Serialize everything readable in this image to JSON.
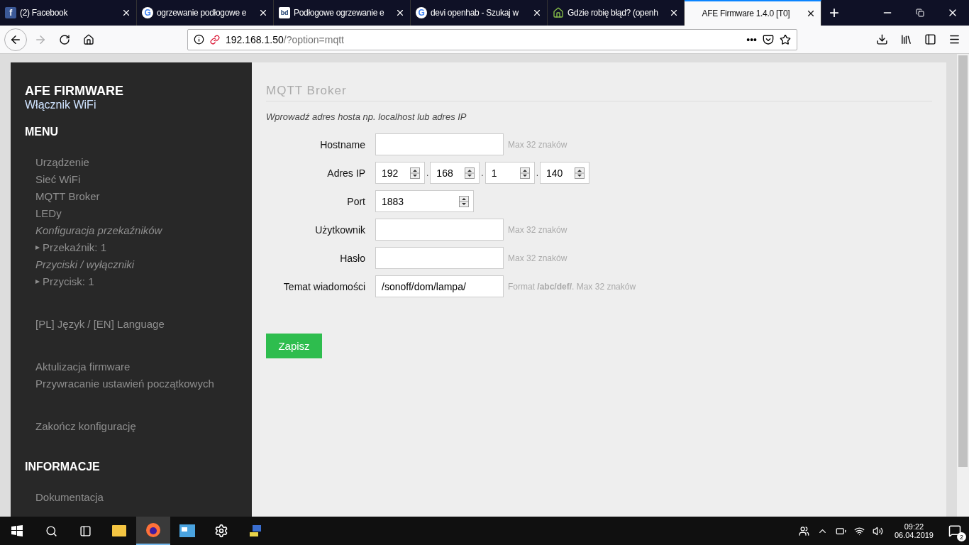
{
  "browser": {
    "tabs": [
      {
        "title": "(2) Facebook",
        "kind": "facebook",
        "favicon_text": "f",
        "selected": false
      },
      {
        "title": "ogrzewanie podłogowe e",
        "kind": "google",
        "favicon_text": "G",
        "selected": false
      },
      {
        "title": "Podłogowe ogrzewanie e",
        "kind": "letters",
        "favicon_text": "bd",
        "selected": false
      },
      {
        "title": "devi openhab - Szukaj w",
        "kind": "google",
        "favicon_text": "G",
        "selected": false
      },
      {
        "title": "Gdzie robię błąd? (openh",
        "kind": "house",
        "selected": false
      },
      {
        "title": "AFE Firmware 1.4.0 [T0]",
        "selected": true
      }
    ],
    "new_tab": "+",
    "url_host": "192.168.1.50",
    "url_path": "/?option=mqtt",
    "page_actions": "•••",
    "forward_disabled": true
  },
  "sidebar": {
    "title": "AFE FIRMWARE",
    "subtitle": "Włącznik WiFi",
    "menu_heading": "MENU",
    "groups": [
      [
        {
          "label": "Urządzenie",
          "kind": "link"
        },
        {
          "label": "Sieć WiFi",
          "kind": "link"
        },
        {
          "label": "MQTT Broker",
          "kind": "link"
        },
        {
          "label": "LEDy",
          "kind": "link"
        },
        {
          "label": "Konfiguracja przekaźników",
          "kind": "section"
        },
        {
          "label": "Przekaźnik: 1",
          "kind": "sub"
        },
        {
          "label": "Przyciski / wyłączniki",
          "kind": "section"
        },
        {
          "label": "Przycisk: 1",
          "kind": "sub"
        }
      ],
      [
        {
          "label": "[PL] Język / [EN] Language",
          "kind": "link"
        }
      ],
      [
        {
          "label": "Aktulizacja firmware",
          "kind": "link"
        },
        {
          "label": "Przywracanie ustawień początkowych",
          "kind": "link"
        }
      ],
      [
        {
          "label": "Zakończ konfigurację",
          "kind": "link"
        }
      ]
    ],
    "info_heading": "INFORMACJE",
    "info_items": [
      {
        "label": "Dokumentacja"
      }
    ]
  },
  "main": {
    "title": "MQTT Broker",
    "intro": "Wprowadź adres hosta np. localhost lub adres IP",
    "fields": [
      {
        "label": "Hostname",
        "kind": "text",
        "hint": "Max 32 znaków"
      },
      {
        "label": "Adres IP",
        "kind": "ip",
        "separator": ".",
        "octets": [
          "192",
          "168",
          "1",
          "140"
        ]
      },
      {
        "label": "Port",
        "kind": "number",
        "value": "1883"
      },
      {
        "label": "Użytkownik",
        "kind": "text",
        "hint": "Max 32 znaków"
      },
      {
        "label": "Hasło",
        "kind": "text",
        "hint": "Max 32 znaków"
      },
      {
        "label": "Temat wiadomości",
        "kind": "text",
        "value": "/sonoff/dom/lampa/",
        "hint": "Format **/abc/def/**. Max 32 znaków"
      }
    ],
    "save_button": "Zapisz"
  },
  "taskbar": {
    "time": "09:22",
    "date": "06.04.2019",
    "notifications": "2"
  }
}
